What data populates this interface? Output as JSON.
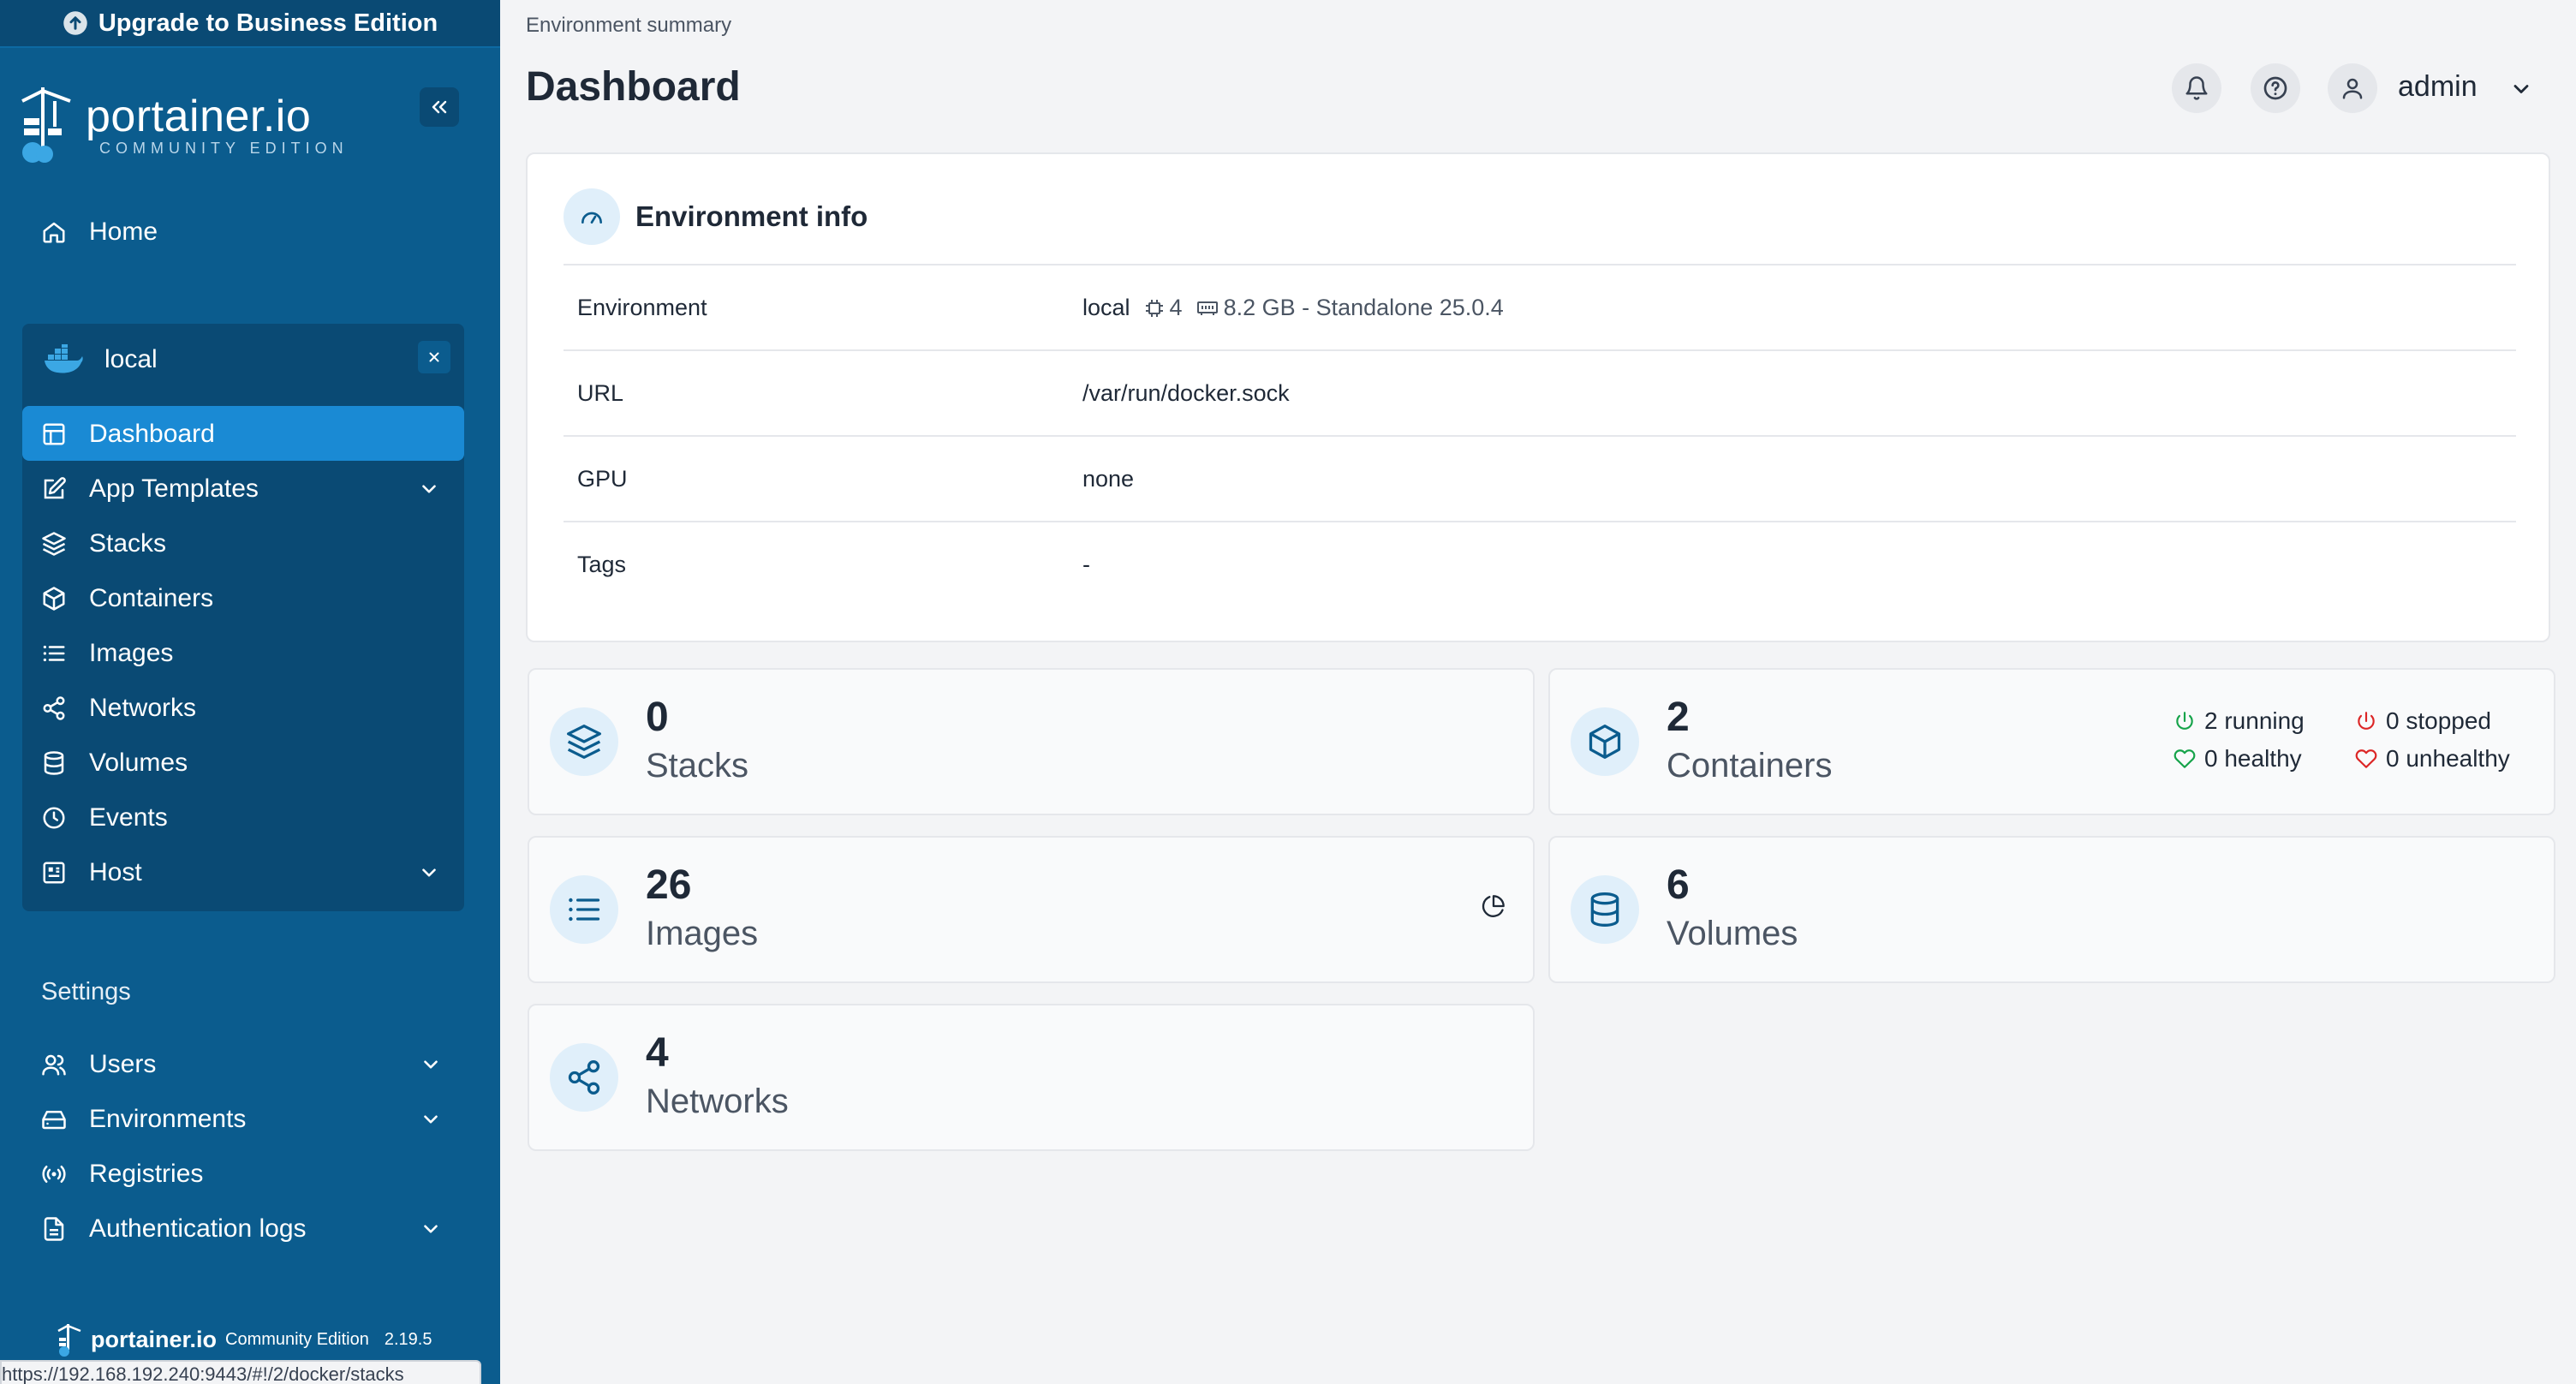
{
  "sidebar": {
    "upgrade_label": "Upgrade to Business Edition",
    "logo_main": "portainer.io",
    "logo_sub": "COMMUNITY EDITION",
    "home_label": "Home",
    "environment": {
      "name": "local",
      "items": [
        {
          "label": "Dashboard",
          "icon": "dashboard-icon",
          "active": true
        },
        {
          "label": "App Templates",
          "icon": "edit-icon",
          "expandable": true
        },
        {
          "label": "Stacks",
          "icon": "layers-icon"
        },
        {
          "label": "Containers",
          "icon": "box-icon"
        },
        {
          "label": "Images",
          "icon": "list-icon"
        },
        {
          "label": "Networks",
          "icon": "share-icon"
        },
        {
          "label": "Volumes",
          "icon": "database-icon"
        },
        {
          "label": "Events",
          "icon": "clock-icon"
        },
        {
          "label": "Host",
          "icon": "host-icon",
          "expandable": true
        }
      ]
    },
    "settings_title": "Settings",
    "settings_items": [
      {
        "label": "Users",
        "icon": "users-icon",
        "expandable": true
      },
      {
        "label": "Environments",
        "icon": "hdd-icon",
        "expandable": true
      },
      {
        "label": "Registries",
        "icon": "radio-icon"
      },
      {
        "label": "Authentication logs",
        "icon": "file-icon",
        "expandable": true
      }
    ],
    "footer_brand": "portainer.io",
    "footer_edition": "Community Edition",
    "footer_version": "2.19.5",
    "status_url": "https://192.168.192.240:9443/#!/2/docker/stacks"
  },
  "header": {
    "breadcrumb": "Environment summary",
    "title": "Dashboard",
    "user": "admin"
  },
  "env_info": {
    "title": "Environment info",
    "rows": [
      {
        "key": "Environment",
        "value": "local",
        "cpu": "4",
        "memory": "8.2 GB - Standalone 25.0.4"
      },
      {
        "key": "URL",
        "value": "/var/run/docker.sock"
      },
      {
        "key": "GPU",
        "value": "none"
      },
      {
        "key": "Tags",
        "value": "-"
      }
    ]
  },
  "stats": {
    "stacks": {
      "count": "0",
      "label": "Stacks"
    },
    "containers": {
      "count": "2",
      "label": "Containers",
      "running": "2 running",
      "stopped": "0 stopped",
      "healthy": "0 healthy",
      "unhealthy": "0 unhealthy"
    },
    "images": {
      "count": "26",
      "label": "Images"
    },
    "volumes": {
      "count": "6",
      "label": "Volumes"
    },
    "networks": {
      "count": "4",
      "label": "Networks"
    }
  },
  "colors": {
    "sidebar_bg": "#0b5c8e",
    "active_item": "#1a8ad4",
    "accent_icon": "#1a8ad4",
    "running_green": "#16a34a",
    "stopped_red": "#dc2626"
  }
}
